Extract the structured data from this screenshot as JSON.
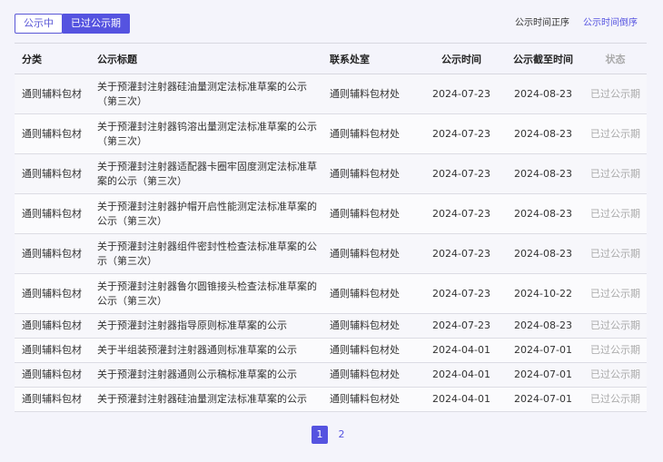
{
  "tabs": {
    "current_label": "公示中",
    "past_label": "已过公示期"
  },
  "sort": {
    "asc_label": "公示时间正序",
    "desc_label": "公示时间倒序"
  },
  "table": {
    "headers": {
      "category": "分类",
      "title": "公示标题",
      "office": "联系处室",
      "time": "公示时间",
      "deadline": "公示截至时间",
      "status": "状态"
    },
    "rows": [
      {
        "category": "通则辅料包材",
        "title": "关于预灌封注射器硅油量测定法标准草案的公示（第三次）",
        "office": "通则辅料包材处",
        "time": "2024-07-23",
        "deadline": "2024-08-23",
        "status": "已过公示期"
      },
      {
        "category": "通则辅料包材",
        "title": "关于预灌封注射器钨溶出量测定法标准草案的公示（第三次）",
        "office": "通则辅料包材处",
        "time": "2024-07-23",
        "deadline": "2024-08-23",
        "status": "已过公示期"
      },
      {
        "category": "通则辅料包材",
        "title": "关于预灌封注射器适配器卡圈牢固度测定法标准草案的公示（第三次）",
        "office": "通则辅料包材处",
        "time": "2024-07-23",
        "deadline": "2024-08-23",
        "status": "已过公示期"
      },
      {
        "category": "通则辅料包材",
        "title": "关于预灌封注射器护帽开启性能测定法标准草案的公示（第三次）",
        "office": "通则辅料包材处",
        "time": "2024-07-23",
        "deadline": "2024-08-23",
        "status": "已过公示期"
      },
      {
        "category": "通则辅料包材",
        "title": "关于预灌封注射器组件密封性检查法标准草案的公示（第三次）",
        "office": "通则辅料包材处",
        "time": "2024-07-23",
        "deadline": "2024-08-23",
        "status": "已过公示期"
      },
      {
        "category": "通则辅料包材",
        "title": "关于预灌封注射器鲁尔圆锥接头检查法标准草案的公示（第三次）",
        "office": "通则辅料包材处",
        "time": "2024-07-23",
        "deadline": "2024-10-22",
        "status": "已过公示期"
      },
      {
        "category": "通则辅料包材",
        "title": "关于预灌封注射器指导原则标准草案的公示",
        "office": "通则辅料包材处",
        "time": "2024-07-23",
        "deadline": "2024-08-23",
        "status": "已过公示期"
      },
      {
        "category": "通则辅料包材",
        "title": "关于半组装预灌封注射器通则标准草案的公示",
        "office": "通则辅料包材处",
        "time": "2024-04-01",
        "deadline": "2024-07-01",
        "status": "已过公示期"
      },
      {
        "category": "通则辅料包材",
        "title": "关于预灌封注射器通则公示稿标准草案的公示",
        "office": "通则辅料包材处",
        "time": "2024-04-01",
        "deadline": "2024-07-01",
        "status": "已过公示期"
      },
      {
        "category": "通则辅料包材",
        "title": "关于预灌封注射器硅油量测定法标准草案的公示",
        "office": "通则辅料包材处",
        "time": "2024-04-01",
        "deadline": "2024-07-01",
        "status": "已过公示期"
      }
    ]
  },
  "pagination": {
    "pages": [
      "1",
      "2"
    ],
    "current": "1"
  },
  "colors": {
    "accent": "#5553e0",
    "status_gray": "#aaaaaa"
  }
}
